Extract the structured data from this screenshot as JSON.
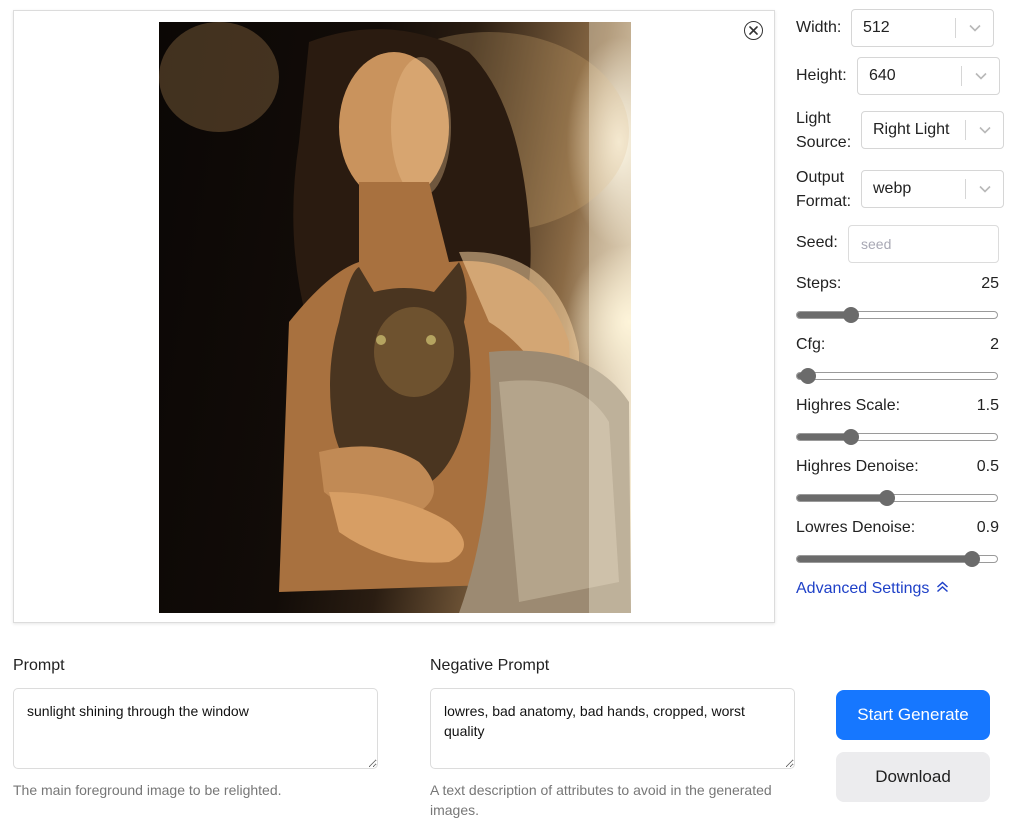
{
  "settings": {
    "width": {
      "label": "Width:",
      "value": "512"
    },
    "height": {
      "label": "Height:",
      "value": "640"
    },
    "light_source": {
      "label_line1": "Light",
      "label_line2": "Source:",
      "value": "Right Light"
    },
    "output_format": {
      "label_line1": "Output",
      "label_line2": "Format:",
      "value": "webp"
    },
    "seed": {
      "label": "Seed:",
      "placeholder": "seed"
    }
  },
  "sliders": [
    {
      "label": "Steps:",
      "value": "25",
      "fraction": 0.27
    },
    {
      "label": "Cfg:",
      "value": "2",
      "fraction": 0.06
    },
    {
      "label": "Highres Scale:",
      "value": "1.5",
      "fraction": 0.27
    },
    {
      "label": "Highres Denoise:",
      "value": "0.5",
      "fraction": 0.45
    },
    {
      "label": "Lowres Denoise:",
      "value": "0.9",
      "fraction": 0.87
    }
  ],
  "advanced_settings_label": "Advanced Settings",
  "prompt": {
    "label": "Prompt",
    "value": "sunlight shining through the window",
    "hint": "The main foreground image to be relighted."
  },
  "negative_prompt": {
    "label": "Negative Prompt",
    "value": "lowres, bad anatomy, bad hands, cropped, worst quality",
    "hint": "A text description of attributes to avoid in the generated images."
  },
  "buttons": {
    "start_generate": "Start Generate",
    "download": "Download"
  },
  "icons": {
    "close": "close-circle-icon",
    "select_arrow": "chevron-down-icon",
    "advanced": "double-chevron-up-icon"
  },
  "colors": {
    "primary": "#1677ff",
    "link": "#1f41c8",
    "slider": "#6b6b6b"
  }
}
